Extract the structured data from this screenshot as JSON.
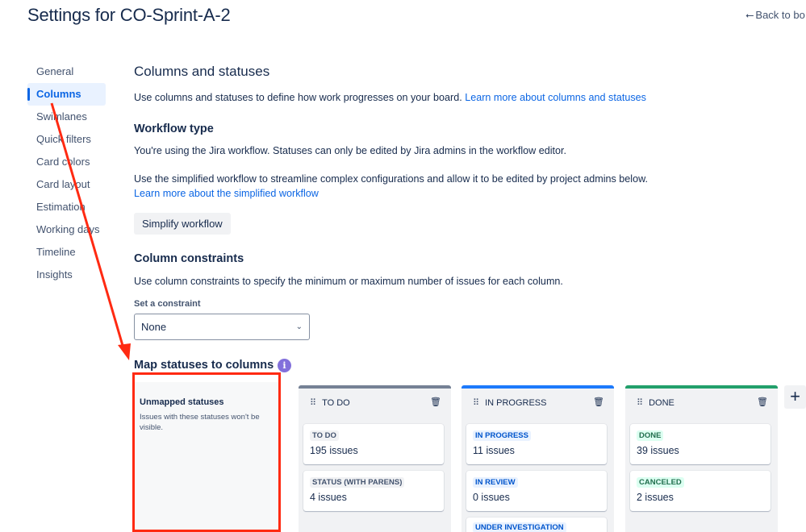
{
  "header": {
    "title": "Settings for CO-Sprint-A-2",
    "back_label": "Back to bo",
    "back_icon": "arrow-left-icon"
  },
  "sidebar": {
    "items": [
      {
        "label": "General"
      },
      {
        "label": "Columns"
      },
      {
        "label": "Swimlanes"
      },
      {
        "label": "Quick filters"
      },
      {
        "label": "Card colors"
      },
      {
        "label": "Card layout"
      },
      {
        "label": "Estimation"
      },
      {
        "label": "Working days"
      },
      {
        "label": "Timeline"
      },
      {
        "label": "Insights"
      }
    ],
    "active_index": 1
  },
  "main": {
    "heading": "Columns and statuses",
    "intro_text": "Use columns and statuses to define how work progresses on your board.",
    "intro_link": "Learn more about columns and statuses",
    "workflow": {
      "heading": "Workflow type",
      "text1": "You're using the Jira workflow. Statuses can only be edited by Jira admins in the workflow editor.",
      "text2": "Use the simplified workflow to streamline complex configurations and allow it to be edited by project admins below.",
      "link": "Learn more about the simplified workflow",
      "button_label": "Simplify workflow"
    },
    "constraints": {
      "heading": "Column constraints",
      "text": "Use column constraints to specify the minimum or maximum number of issues for each column.",
      "select_label": "Set a constraint",
      "select_value": "None"
    },
    "map": {
      "heading": "Map statuses to columns",
      "info_glyph": "i",
      "unmapped": {
        "title": "Unmapped statuses",
        "description": "Issues with these statuses won't be visible."
      },
      "columns": [
        {
          "name": "TO DO",
          "color": "#758195",
          "statuses": [
            {
              "name": "TO DO",
              "count": "195 issues",
              "style": "todo"
            },
            {
              "name": "STATUS (WITH PARENS)",
              "count": "4 issues",
              "style": "todo"
            }
          ]
        },
        {
          "name": "IN PROGRESS",
          "color": "#1d7afc",
          "statuses": [
            {
              "name": "IN PROGRESS",
              "count": "11 issues",
              "style": "prog"
            },
            {
              "name": "IN REVIEW",
              "count": "0 issues",
              "style": "prog"
            },
            {
              "name": "UNDER INVESTIGATION",
              "count": "",
              "style": "prog"
            }
          ]
        },
        {
          "name": "DONE",
          "color": "#22a06b",
          "statuses": [
            {
              "name": "DONE",
              "count": "39 issues",
              "style": "done"
            },
            {
              "name": "CANCELED",
              "count": "2 issues",
              "style": "done"
            }
          ]
        }
      ],
      "add_column_label": "+"
    }
  },
  "annotation": {
    "color": "#ff2a12"
  }
}
